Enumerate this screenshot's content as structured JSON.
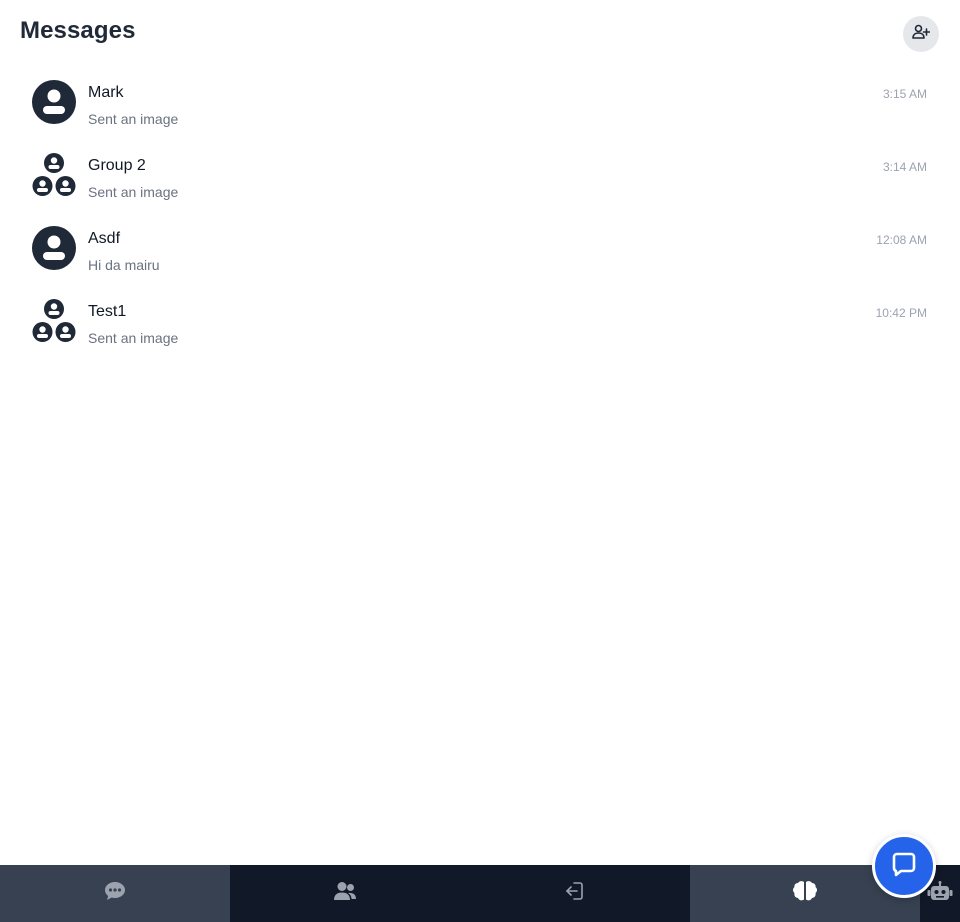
{
  "header": {
    "title": "Messages",
    "add_contact_icon": "user-plus-icon"
  },
  "conversations": [
    {
      "name": "Mark",
      "preview": "Sent an image",
      "time": "3:15 AM",
      "type": "direct",
      "avatar_icon": "user-circle-icon"
    },
    {
      "name": "Group 2",
      "preview": "Sent an image",
      "time": "3:14 AM",
      "type": "group",
      "avatar_icon": "group-icon"
    },
    {
      "name": "Asdf",
      "preview": "Hi da mairu",
      "time": "12:08 AM",
      "type": "direct",
      "avatar_icon": "user-circle-icon"
    },
    {
      "name": "Test1",
      "preview": "Sent an image",
      "time": "10:42 PM",
      "type": "group",
      "avatar_icon": "group-icon"
    }
  ],
  "bottom_nav": {
    "tabs": [
      {
        "icon": "chat-bubble-icon",
        "active": true
      },
      {
        "icon": "users-icon",
        "active": false
      },
      {
        "icon": "logout-icon",
        "active": false
      },
      {
        "icon": "brain-icon",
        "active": true
      },
      {
        "icon": "robot-icon",
        "active": false
      }
    ]
  },
  "fab": {
    "icon": "message-bubble-icon"
  },
  "colors": {
    "accent": "#2563eb",
    "nav_background": "#111827",
    "nav_active": "#374151",
    "avatar": "#1f2937",
    "muted_text": "#6b7280",
    "time_text": "#9ca3af"
  }
}
